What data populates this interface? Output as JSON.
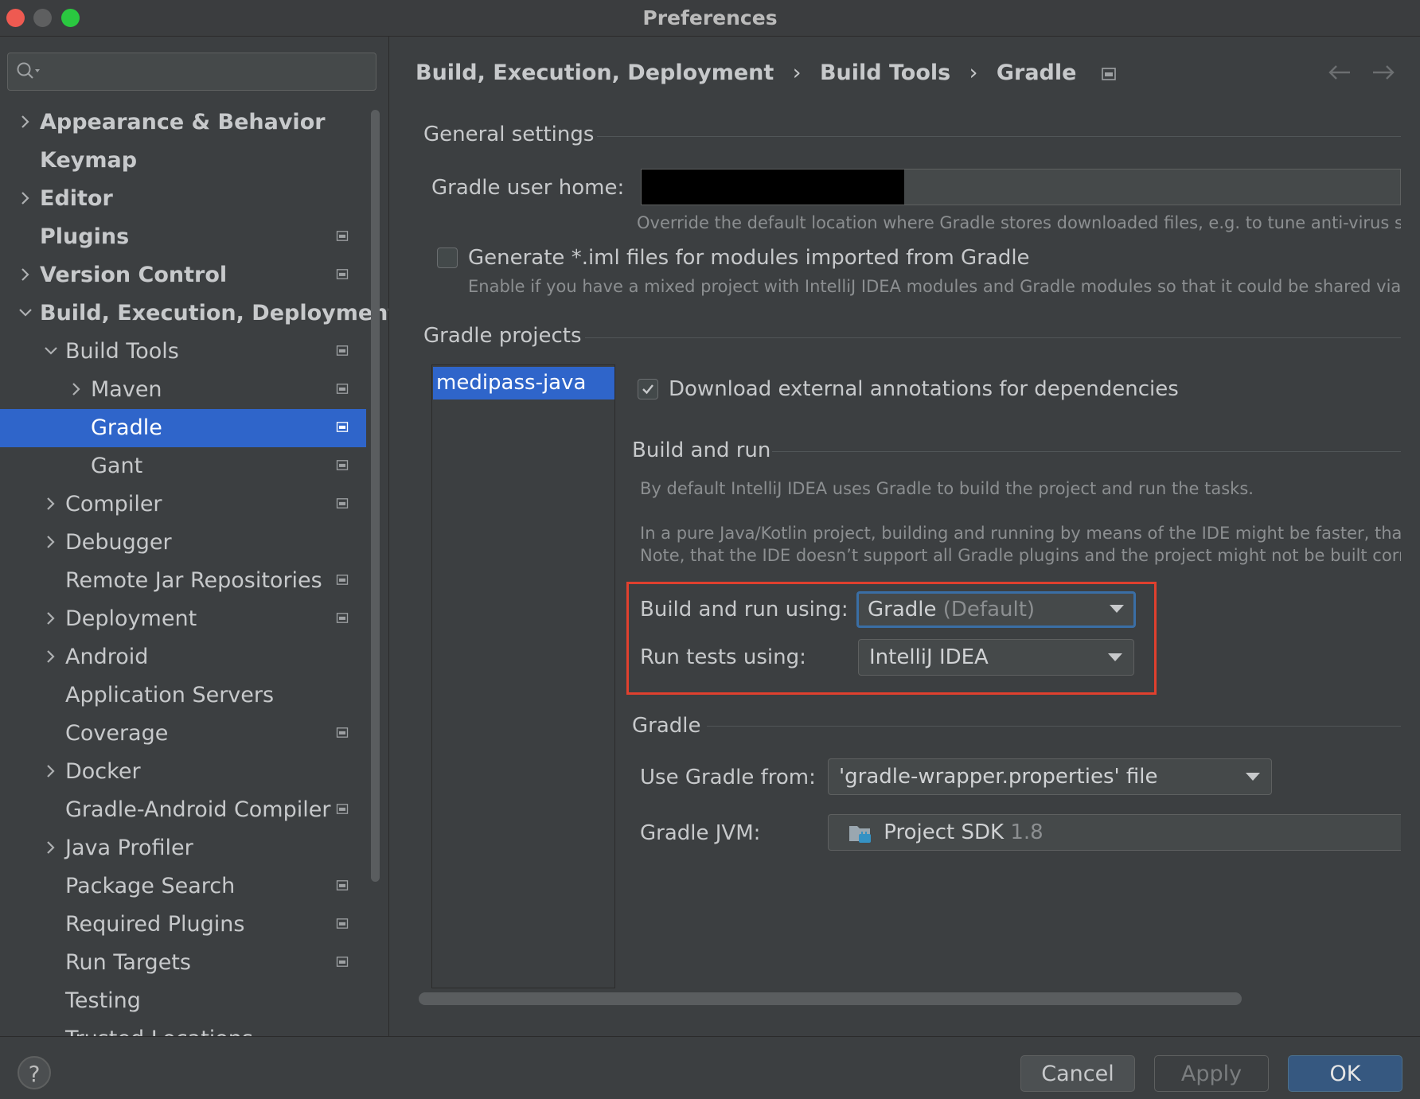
{
  "window": {
    "title": "Preferences",
    "traffic_lights": {
      "close": "#ee5a51",
      "minimize": "#5e5f60",
      "zoom": "#2ac840"
    }
  },
  "search": {
    "icon": "search-icon",
    "placeholder": ""
  },
  "tree": [
    {
      "label": "Appearance & Behavior",
      "depth": 0,
      "expandable": true,
      "expanded": false,
      "bold": true,
      "project_icon": false
    },
    {
      "label": "Keymap",
      "depth": 0,
      "expandable": false,
      "bold": true,
      "project_icon": false
    },
    {
      "label": "Editor",
      "depth": 0,
      "expandable": true,
      "expanded": false,
      "bold": true,
      "project_icon": false
    },
    {
      "label": "Plugins",
      "depth": 0,
      "expandable": false,
      "bold": true,
      "project_icon": true
    },
    {
      "label": "Version Control",
      "depth": 0,
      "expandable": true,
      "expanded": false,
      "bold": true,
      "project_icon": true
    },
    {
      "label": "Build, Execution, Deployment",
      "depth": 0,
      "expandable": true,
      "expanded": true,
      "bold": true,
      "project_icon": false
    },
    {
      "label": "Build Tools",
      "depth": 1,
      "expandable": true,
      "expanded": true,
      "bold": false,
      "project_icon": true
    },
    {
      "label": "Maven",
      "depth": 2,
      "expandable": true,
      "expanded": false,
      "bold": false,
      "project_icon": true
    },
    {
      "label": "Gradle",
      "depth": 2,
      "expandable": false,
      "bold": false,
      "project_icon": true,
      "selected": true
    },
    {
      "label": "Gant",
      "depth": 2,
      "expandable": false,
      "bold": false,
      "project_icon": true
    },
    {
      "label": "Compiler",
      "depth": 1,
      "expandable": true,
      "expanded": false,
      "bold": false,
      "project_icon": true
    },
    {
      "label": "Debugger",
      "depth": 1,
      "expandable": true,
      "expanded": false,
      "bold": false,
      "project_icon": false
    },
    {
      "label": "Remote Jar Repositories",
      "depth": 1,
      "expandable": false,
      "bold": false,
      "project_icon": true
    },
    {
      "label": "Deployment",
      "depth": 1,
      "expandable": true,
      "expanded": false,
      "bold": false,
      "project_icon": true
    },
    {
      "label": "Android",
      "depth": 1,
      "expandable": true,
      "expanded": false,
      "bold": false,
      "project_icon": false
    },
    {
      "label": "Application Servers",
      "depth": 1,
      "expandable": false,
      "bold": false,
      "project_icon": false
    },
    {
      "label": "Coverage",
      "depth": 1,
      "expandable": false,
      "bold": false,
      "project_icon": true
    },
    {
      "label": "Docker",
      "depth": 1,
      "expandable": true,
      "expanded": false,
      "bold": false,
      "project_icon": false
    },
    {
      "label": "Gradle-Android Compiler",
      "depth": 1,
      "expandable": false,
      "bold": false,
      "project_icon": true
    },
    {
      "label": "Java Profiler",
      "depth": 1,
      "expandable": true,
      "expanded": false,
      "bold": false,
      "project_icon": false
    },
    {
      "label": "Package Search",
      "depth": 1,
      "expandable": false,
      "bold": false,
      "project_icon": true
    },
    {
      "label": "Required Plugins",
      "depth": 1,
      "expandable": false,
      "bold": false,
      "project_icon": true
    },
    {
      "label": "Run Targets",
      "depth": 1,
      "expandable": false,
      "bold": false,
      "project_icon": true
    },
    {
      "label": "Testing",
      "depth": 1,
      "expandable": false,
      "bold": false,
      "project_icon": false
    },
    {
      "label": "Trusted Locations",
      "depth": 1,
      "expandable": false,
      "bold": false,
      "project_icon": false
    }
  ],
  "breadcrumb": {
    "items": [
      "Build, Execution, Deployment",
      "Build Tools",
      "Gradle"
    ],
    "separator": "›",
    "back_icon": "arrow-left-icon",
    "forward_icon": "arrow-right-icon"
  },
  "general": {
    "title": "General settings",
    "user_home_label": "Gradle user home:",
    "user_home_value": "",
    "user_home_hint": "Override the default location where Gradle stores downloaded files, e.g. to tune anti-virus softw",
    "iml_checkbox_label": "Generate *.iml files for modules imported from Gradle",
    "iml_checked": false,
    "iml_hint": "Enable if you have a mixed project with IntelliJ IDEA modules and Gradle modules so that it could be shared via VCS"
  },
  "projects": {
    "title": "Gradle projects",
    "items": [
      "medipass-java"
    ],
    "download_annotations_label": "Download external annotations for dependencies",
    "download_annotations_checked": true
  },
  "build_run": {
    "title": "Build and run",
    "desc1": "By default IntelliJ IDEA uses Gradle to build the project and run the tasks.",
    "desc2": "In a pure Java/Kotlin project, building and running by means of the IDE might be faster, thanks",
    "desc3": "Note, that the IDE doesn’t support all Gradle plugins and the project might not be built correctl",
    "build_using_label": "Build and run using:",
    "build_using_value": "Gradle",
    "build_using_suffix": "(Default)",
    "tests_using_label": "Run tests using:",
    "tests_using_value": "IntelliJ IDEA",
    "highlight_color": "#e0402e"
  },
  "gradle": {
    "title": "Gradle",
    "use_from_label": "Use Gradle from:",
    "use_from_value": "'gradle-wrapper.properties' file",
    "jvm_label": "Gradle JVM:",
    "jvm_value": "Project SDK",
    "jvm_version": "1.8",
    "jvm_icon": "folder-sdk-icon"
  },
  "buttons": {
    "help": "?",
    "cancel": "Cancel",
    "apply": "Apply",
    "ok": "OK"
  },
  "colors": {
    "accent": "#2f65ca",
    "background": "#3c3f41",
    "ok_button": "#365880"
  }
}
